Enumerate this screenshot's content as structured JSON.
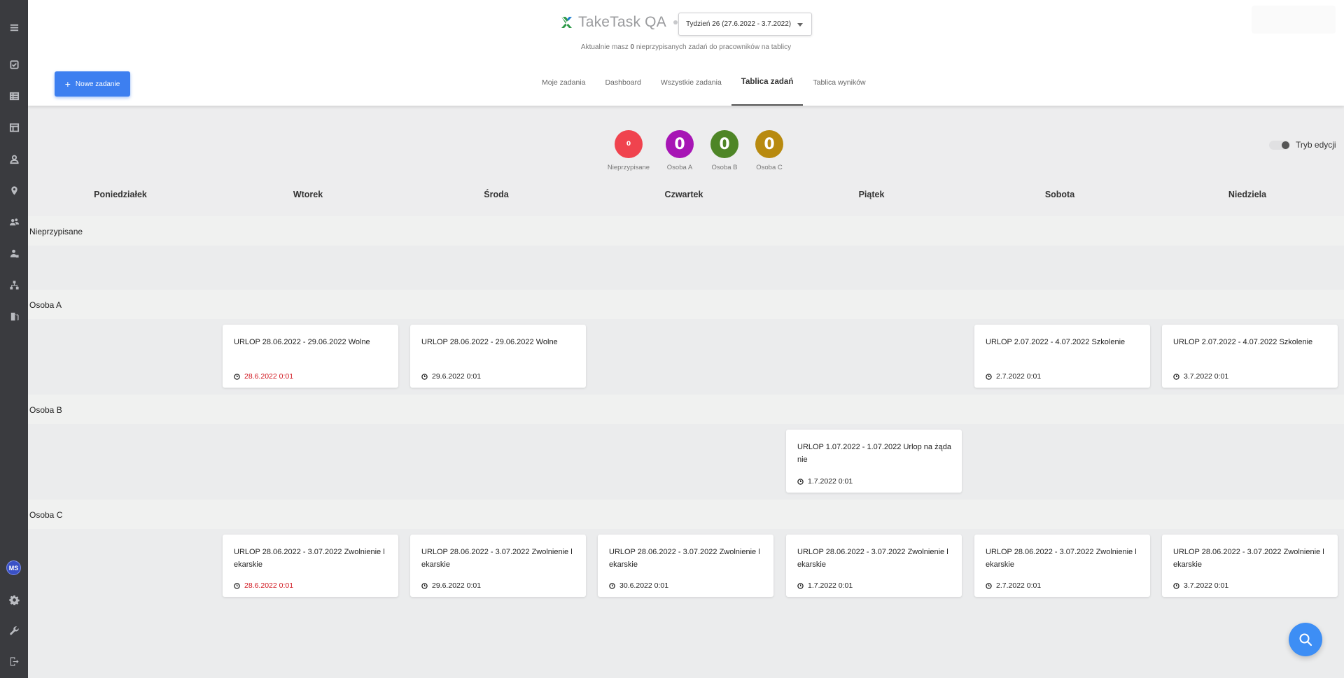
{
  "app": {
    "title": "TakeTask QA",
    "week_select": "Tydzień 26 (27.6.2022 - 3.7.2022)",
    "info_prefix": "Aktualnie masz",
    "info_count": "0",
    "info_suffix": "nieprzypisanych zadań do pracowników na tablicy",
    "new_task": "Nowe zadanie",
    "accent": "#3d7ff0"
  },
  "tabs": [
    "Moje zadania",
    "Dashboard",
    "Wszystkie zadania",
    "Tablica zadań",
    "Tablica wyników"
  ],
  "active_tab": "Tablica zadań",
  "sidebar": {
    "icons": [
      "menu-icon",
      "checklist-icon",
      "table-icon",
      "layout-icon",
      "user-icon",
      "location-pin-icon",
      "users-icon",
      "user-group-icon",
      "hierarchy-icon",
      "fuel-icon"
    ],
    "avatar": "MS",
    "bottom_icons": [
      "gear-icon",
      "wrench-icon",
      "logout-icon"
    ]
  },
  "people": [
    {
      "name": "Nieprzypisane",
      "badge": "0",
      "color": "#f0434e"
    },
    {
      "name": "Osoba A",
      "badge": "0",
      "color": "#a715b5"
    },
    {
      "name": "Osoba B",
      "badge": "0",
      "color": "#4e8526"
    },
    {
      "name": "Osoba C",
      "badge": "0",
      "color": "#b88a0f"
    }
  ],
  "edit_mode_label": "Tryb edycji",
  "days": [
    "Poniedziałek",
    "Wtorek",
    "Środa",
    "Czwartek",
    "Piątek",
    "Sobota",
    "Niedziela"
  ],
  "rows": {
    "unassigned": "Nieprzypisane",
    "a": "Osoba A",
    "b": "Osoba B",
    "c": "Osoba C"
  },
  "cards": {
    "a_tue": {
      "title": "URLOP 28.06.2022 - 29.06.2022 Wolne",
      "date": "28.6.2022 0:01"
    },
    "a_wed": {
      "title": "URLOP 28.06.2022 - 29.06.2022 Wolne",
      "date": "29.6.2022 0:01"
    },
    "a_sat": {
      "title": "URLOP 2.07.2022 - 4.07.2022 Szkolenie",
      "date": "2.7.2022 0:01"
    },
    "a_sun": {
      "title": "URLOP 2.07.2022 - 4.07.2022 Szkolenie",
      "date": "3.7.2022 0:01"
    },
    "b_fri": {
      "title": "URLOP 1.07.2022 - 1.07.2022 Urlop na żądanie",
      "date": "1.7.2022 0:01"
    },
    "c_tue": {
      "title": "URLOP 28.06.2022 - 3.07.2022 Zwolnienie lekarskie",
      "date": "28.6.2022 0:01"
    },
    "c_wed": {
      "title": "URLOP 28.06.2022 - 3.07.2022 Zwolnienie lekarskie",
      "date": "29.6.2022 0:01"
    },
    "c_thu": {
      "title": "URLOP 28.06.2022 - 3.07.2022 Zwolnienie lekarskie",
      "date": "30.6.2022 0:01"
    },
    "c_fri": {
      "title": "URLOP 28.06.2022 - 3.07.2022 Zwolnienie lekarskie",
      "date": "1.7.2022 0:01"
    },
    "c_sat": {
      "title": "URLOP 28.06.2022 - 3.07.2022 Zwolnienie lekarskie",
      "date": "2.7.2022 0:01"
    },
    "c_sun": {
      "title": "URLOP 28.06.2022 - 3.07.2022 Zwolnienie lekarskie",
      "date": "3.7.2022 0:01"
    }
  },
  "overdue_color": "#d0121b"
}
